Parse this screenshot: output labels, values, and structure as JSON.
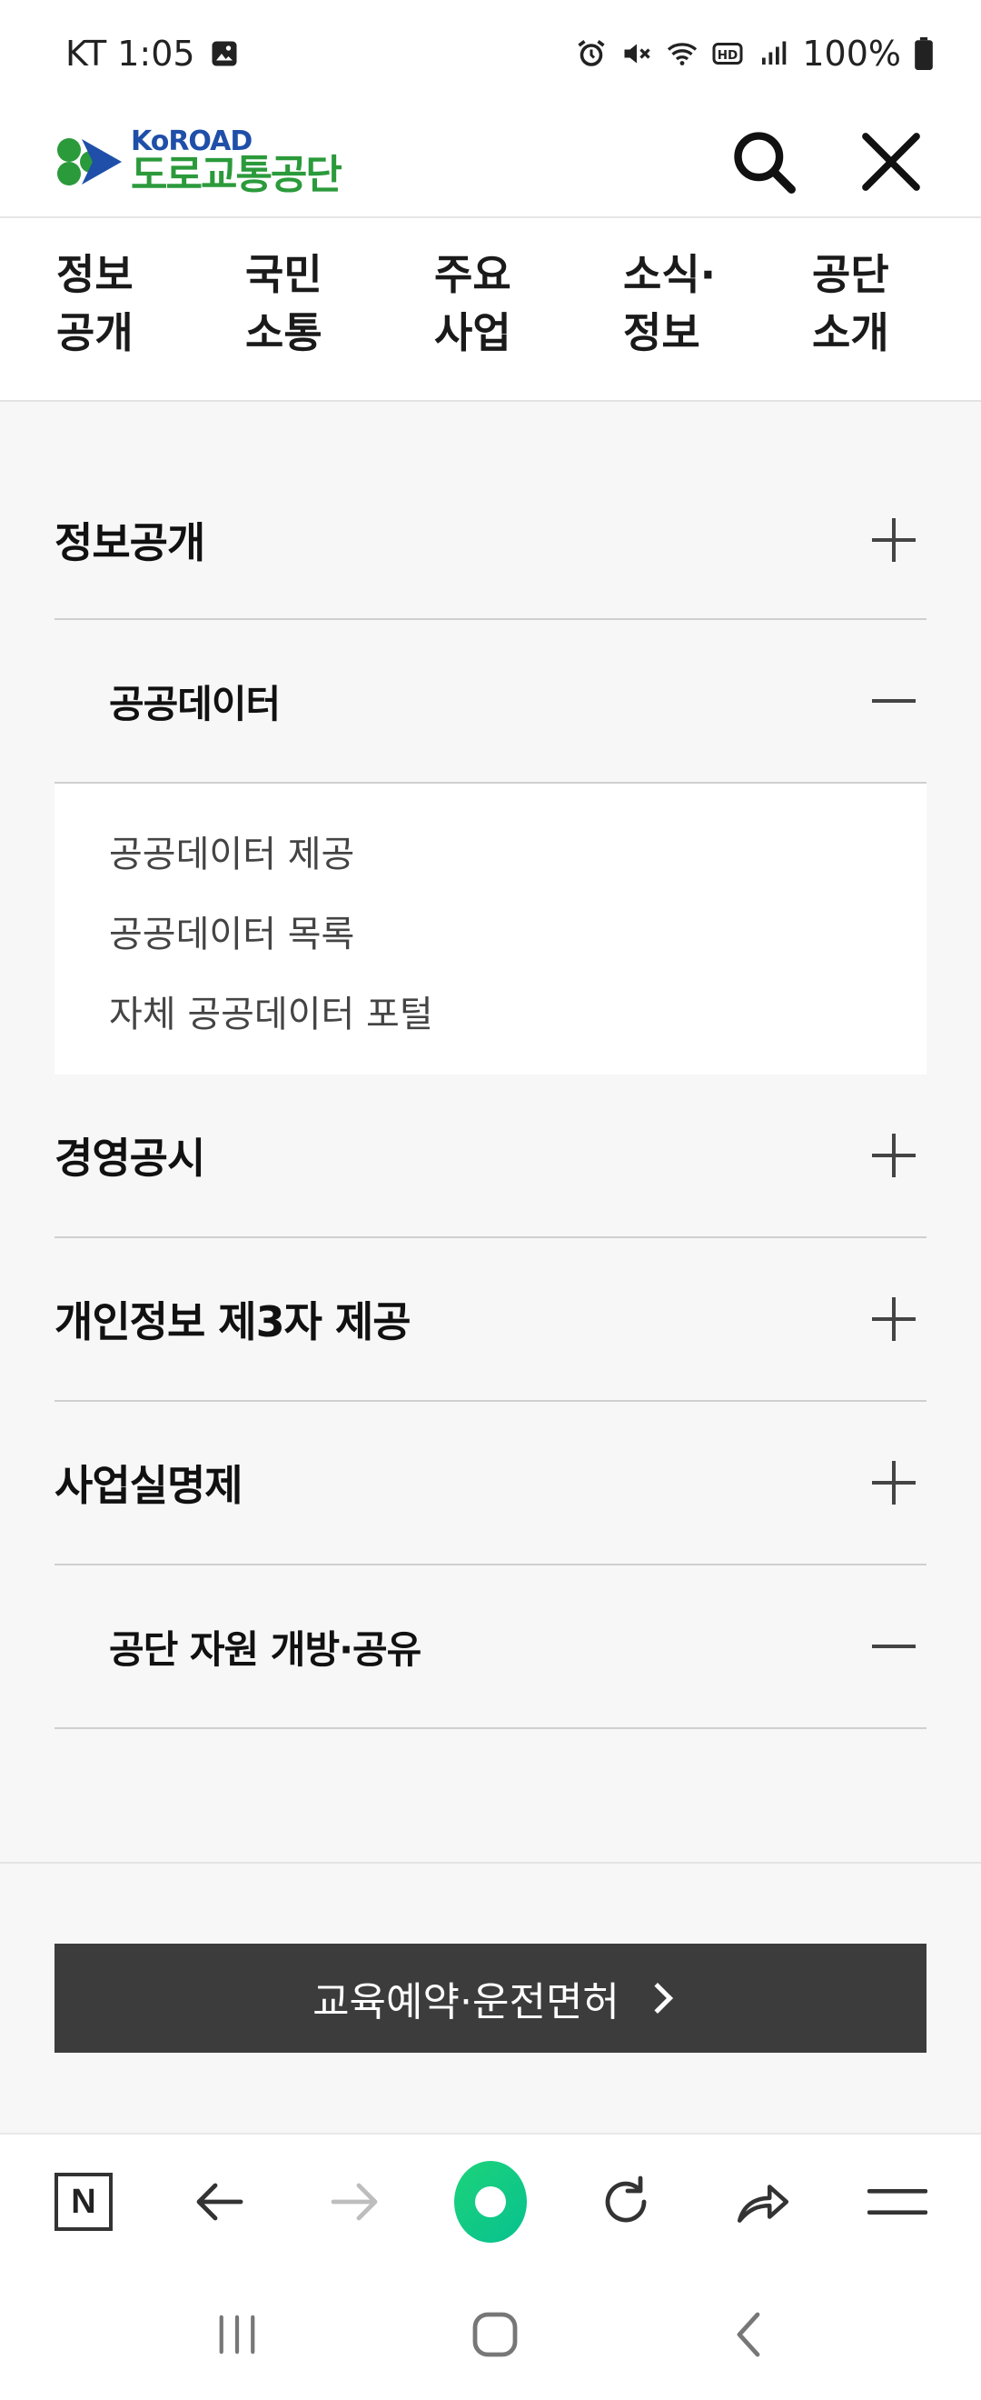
{
  "status_bar": {
    "carrier_time": "KT 1:05",
    "battery": "100%"
  },
  "header": {
    "logo_en": "KoROAD",
    "logo_ko": "도로교통공단"
  },
  "top_nav": [
    {
      "label": "정보\n공개"
    },
    {
      "label": "국민\n소통"
    },
    {
      "label": "주요\n사업"
    },
    {
      "label": "소식·\n정보"
    },
    {
      "label": "공단\n소개"
    }
  ],
  "menu": {
    "info_disclosure": "정보공개",
    "public_data": "공공데이터",
    "public_data_links": [
      "공공데이터 제공",
      "공공데이터 목록",
      "자체 공공데이터 포털"
    ],
    "management_notice": "경영공시",
    "third_party": "개인정보 제3자 제공",
    "project_realname": "사업실명제",
    "resource_open": "공단 자원 개방·공유"
  },
  "cta": {
    "label": "교육예약·운전면허"
  },
  "toolbar": {
    "n_label": "N"
  }
}
